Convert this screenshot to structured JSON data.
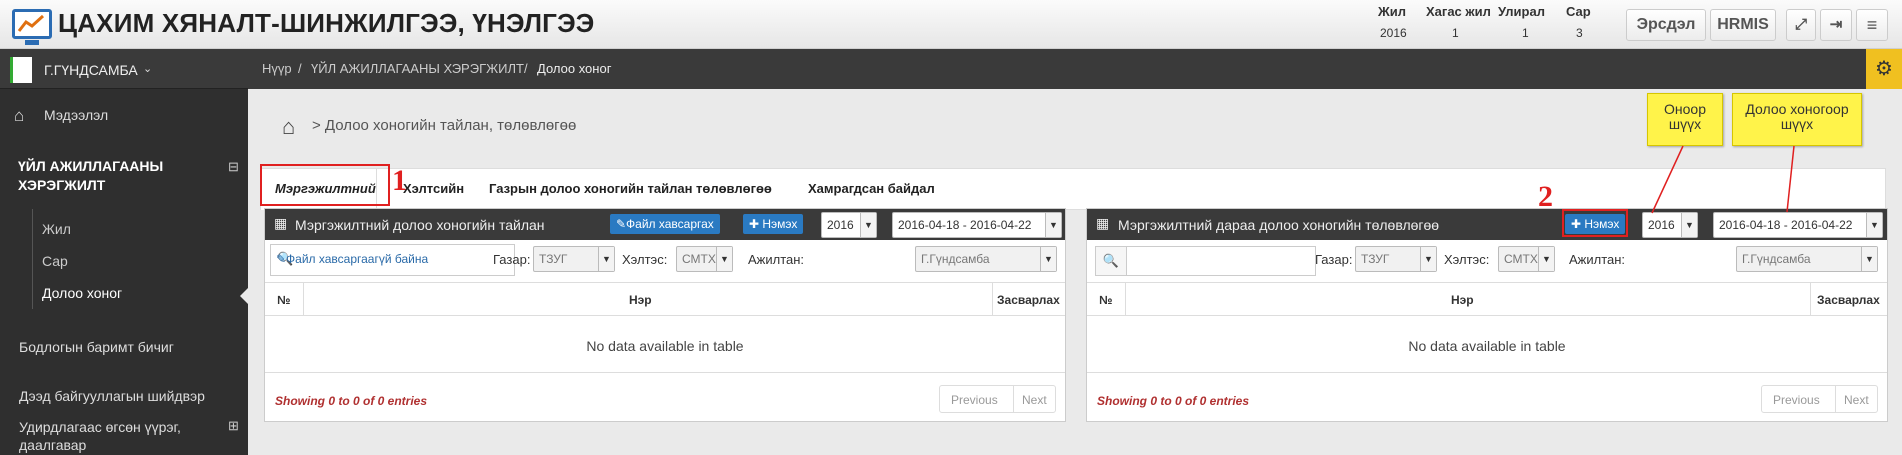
{
  "header": {
    "title": "ЦАХИМ ХЯНАЛТ-ШИНЖИЛГЭЭ, ҮНЭЛГЭЭ",
    "buttons": {
      "ersdel": "Эрсдэл",
      "hrmis": "HRMIS"
    },
    "icons": [
      "expand-icon",
      "logout-icon",
      "menu-icon"
    ]
  },
  "period": {
    "headers": [
      "Жил",
      "Хагас жил",
      "Улирал",
      "Сар"
    ],
    "values": [
      "2016",
      "1",
      "1",
      "3"
    ]
  },
  "sidebar": {
    "user": "Г.ГҮНДСАМБА",
    "items": [
      {
        "label": "Мэдээлэл"
      },
      {
        "label": "ҮЙЛ АЖИЛЛАГААНЫ ХЭРЭГЖИЛТ"
      },
      {
        "label": "Жил"
      },
      {
        "label": "Сар"
      },
      {
        "label": "Долоо хоног"
      },
      {
        "label": "Бодлогын баримт бичиг"
      },
      {
        "label": "Дээд байгууллагын шийдвэр"
      },
      {
        "label": "Удирдлагаас өгсөн үүрэг, даалгавар"
      }
    ],
    "collapse": "⊟",
    "expand": "⊞"
  },
  "breadcrumb": {
    "items": [
      "Нүүр",
      "ҮЙЛ АЖИЛЛАГААНЫ ХЭРЭГЖИЛТ",
      "Долоо хоног"
    ],
    "sep": "/"
  },
  "page": {
    "subtitle": "> Долоо хоногийн тайлан, төлөвлөгөө"
  },
  "tabs": [
    "Мэргэжилтний",
    "Хэлтсийн",
    "Газрын долоо хоногийн тайлан төлөвлөгөө",
    "Хамрагдсан байдал"
  ],
  "left_panel": {
    "title": "Мэргэжилтний долоо хоногийн тайлан",
    "file_button": "✎Файл хавсаргах",
    "add_button": "✚ Нэмэх",
    "year": "2016",
    "week": "2016-04-18 - 2016-04-22",
    "no_file": "✎Файл хавсаргаагүй байна",
    "filters": {
      "place_label": "Газар:",
      "place": "ТЗУГ",
      "dept_label": "Хэлтэс:",
      "dept": "СМТХ",
      "emp_label": "Ажилтан:",
      "emp": "Г.Гүндсамба"
    },
    "columns": [
      "№",
      "Нэр",
      "Засварлах"
    ],
    "empty": "No data available in table",
    "showing": "Showing 0 to 0 of 0 entries",
    "prev": "Previous",
    "next": "Next"
  },
  "right_panel": {
    "title": "Мэргэжилтний дараа долоо хоногийн төлөвлөгөө",
    "add_button": "✚ Нэмэх",
    "year": "2016",
    "week": "2016-04-18 - 2016-04-22",
    "filters": {
      "place_label": "Газар:",
      "place": "ТЗУГ",
      "dept_label": "Хэлтэс:",
      "dept": "СМТХ",
      "emp_label": "Ажилтан:",
      "emp": "Г.Гүндсамба"
    },
    "columns": [
      "№",
      "Нэр",
      "Засварлах"
    ],
    "empty": "No data available in table",
    "showing": "Showing 0 to 0 of 0 entries",
    "prev": "Previous",
    "next": "Next"
  },
  "annotations": {
    "note_year": "Оноор шүүх",
    "note_week": "Долоо хоногоор шүүх",
    "num1": "1",
    "num2": "2"
  },
  "colors": {
    "accent_blue": "#2a7ac2",
    "sidebar_bg": "#2f2f2f",
    "annotation_red": "#e02020",
    "note_yellow": "#fff34a",
    "gear_yellow": "#f0c020"
  }
}
